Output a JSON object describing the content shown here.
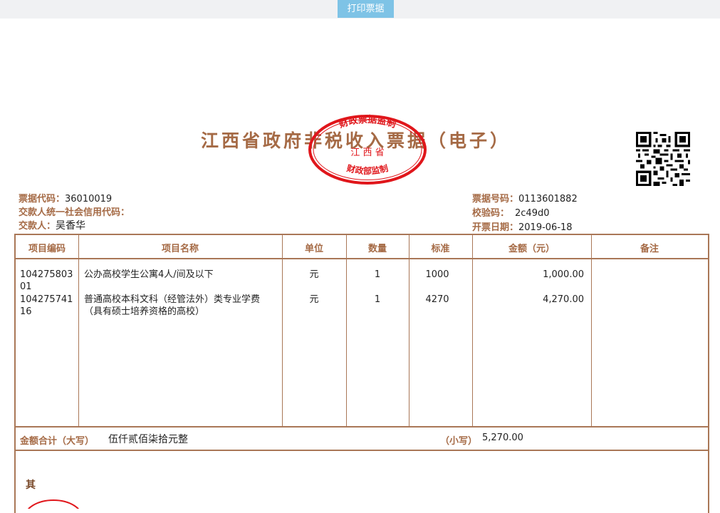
{
  "toolbar": {
    "print_label": "打印票据"
  },
  "receipt": {
    "title": "江西省政府非税收入票据（电子）",
    "seal": {
      "top_text": "财政票据监制",
      "middle_text": "江 西 省",
      "bottom_text": "财政部监制"
    },
    "left_info": [
      {
        "label": "票据代码：",
        "value": "36010019"
      },
      {
        "label": "交款人统一社会信用代码：",
        "value": ""
      },
      {
        "label": "交款人：",
        "value": "吴香华"
      }
    ],
    "right_info": [
      {
        "label": "票据号码：",
        "value": "0113601882"
      },
      {
        "label": "校验码：",
        "value": "2c49d0"
      },
      {
        "label": "开票日期：",
        "value": "2019-06-18"
      }
    ],
    "table": {
      "headers": [
        "项目编码",
        "项目名称",
        "单位",
        "数量",
        "标准",
        "金额（元）",
        "备注"
      ],
      "rows": [
        {
          "code": "10427580301",
          "name": "公办高校学生公寓4人/间及以下",
          "unit": "元",
          "qty": "1",
          "std": "1000",
          "amount": "1,000.00",
          "note": ""
        },
        {
          "code": "10427574116",
          "name": "普通高校本科文科（经管法外）类专业学费（具有硕士培养资格的高校）",
          "unit": "元",
          "qty": "1",
          "std": "4270",
          "amount": "4,270.00",
          "note": ""
        }
      ]
    },
    "total": {
      "upper_label": "金额合计（大写）",
      "upper_value": "伍仟贰佰柒拾元整",
      "lower_label": "（小写）",
      "lower_value": "5,270.00"
    },
    "other_label": "其"
  }
}
